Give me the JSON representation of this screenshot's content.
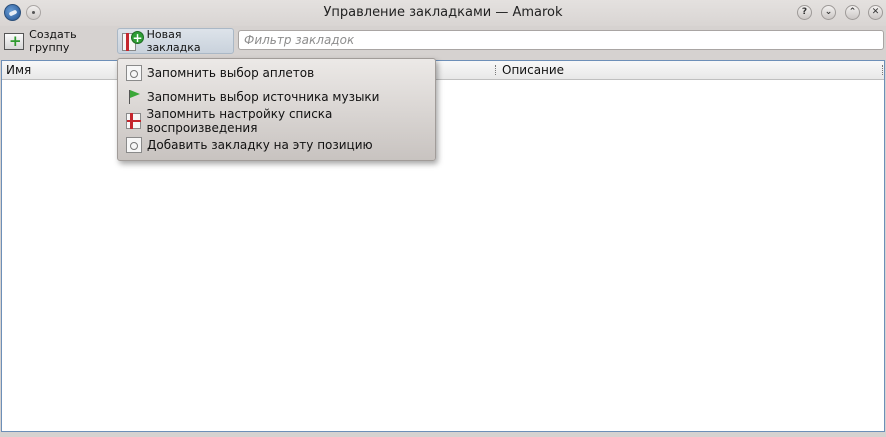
{
  "window": {
    "title": "Управление закладками — Amarok",
    "buttons": {
      "help": "?",
      "minimize": "⌄",
      "maximize": "⌃",
      "close": "✕"
    }
  },
  "toolbar": {
    "create_group": "Создать группу",
    "new_bookmark": "Новая закладка",
    "filter_placeholder": "Фильтр закладок"
  },
  "tree": {
    "columns": [
      "Имя",
      "Описание"
    ]
  },
  "menu": {
    "items": [
      {
        "label": "Запомнить выбор аплетов",
        "icon": "document-icon"
      },
      {
        "label": "Запомнить выбор источника музыки",
        "icon": "flag-icon"
      },
      {
        "label": "Запомнить настройку списка воспроизведения",
        "icon": "playlist-icon"
      },
      {
        "label": "Добавить закладку на эту позицию",
        "icon": "document-icon"
      }
    ]
  },
  "colors": {
    "accent": "#6d8fb8",
    "new_button_bg": "#c9d2dc",
    "window_bg": "#d6d2d0"
  }
}
